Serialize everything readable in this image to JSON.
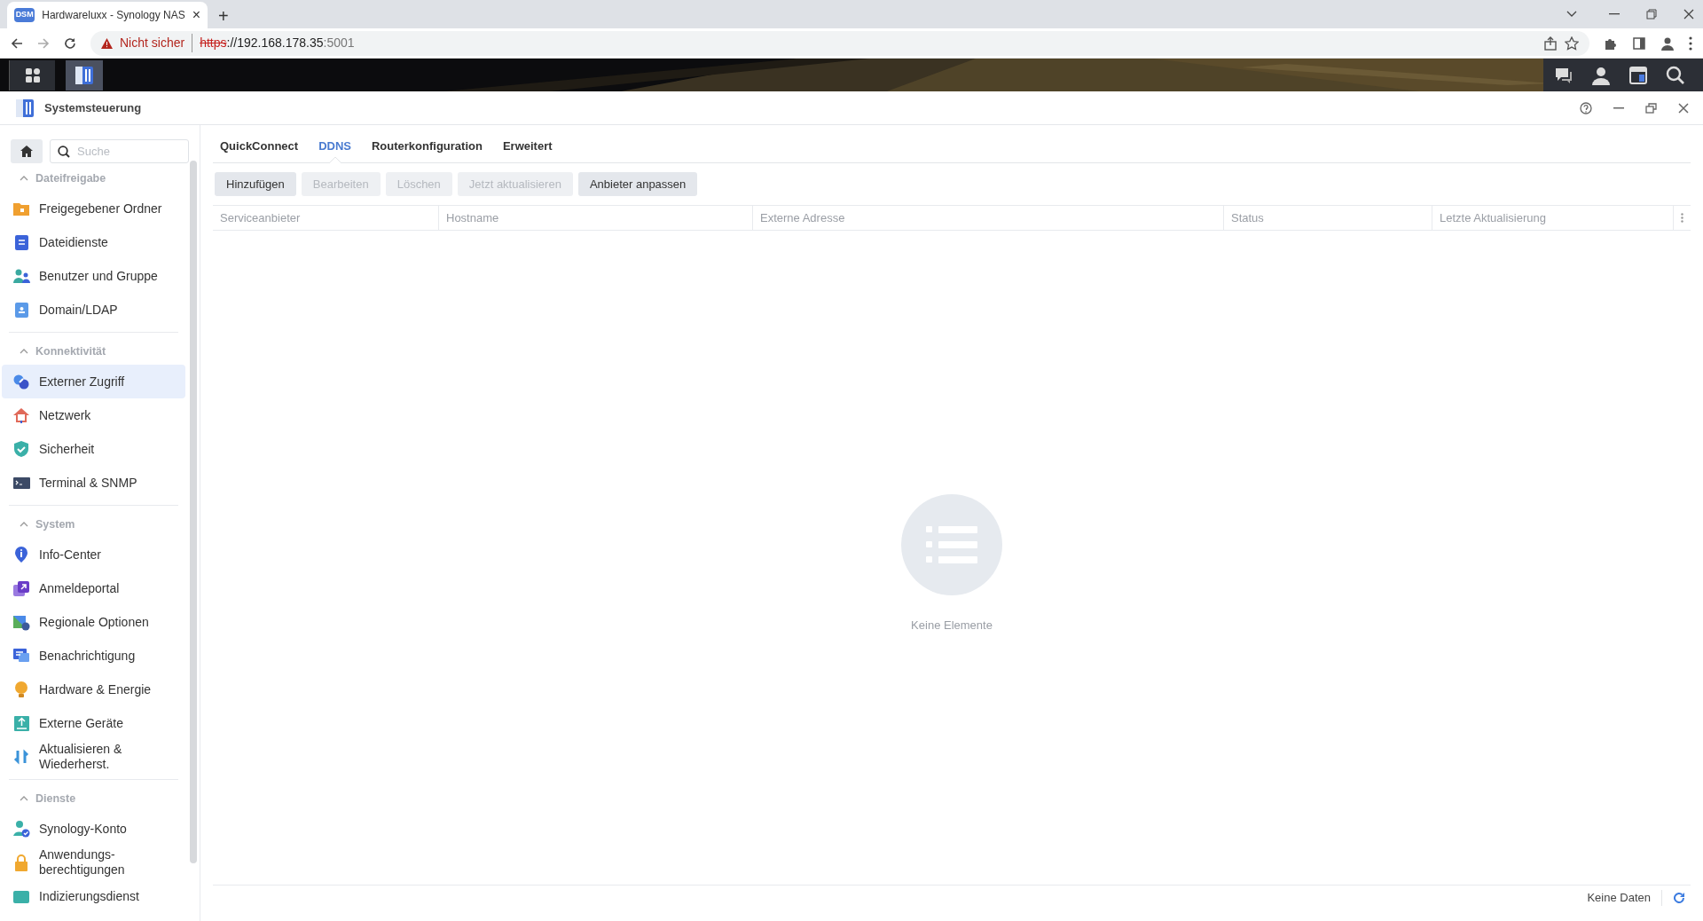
{
  "browser": {
    "tab": {
      "favicon": "DSM",
      "title": "Hardwareluxx - Synology NAS",
      "close": "×"
    },
    "new_tab": "+",
    "address": {
      "warning": "Nicht sicher",
      "scheme": "https",
      "rest": "://192.168.178.35",
      "port": ":5001"
    }
  },
  "window": {
    "title": "Systemsteuerung"
  },
  "sidebar": {
    "search": {
      "placeholder": "Suche"
    },
    "sections": [
      {
        "title": "Dateifreigabe",
        "expanded": true,
        "items": [
          {
            "label": "Freigegebener Ordner",
            "selected": false
          },
          {
            "label": "Dateidienste",
            "selected": false
          },
          {
            "label": "Benutzer und Gruppe",
            "selected": false
          },
          {
            "label": "Domain/LDAP",
            "selected": false
          }
        ]
      },
      {
        "title": "Konnektivität",
        "expanded": true,
        "items": [
          {
            "label": "Externer Zugriff",
            "selected": true
          },
          {
            "label": "Netzwerk",
            "selected": false
          },
          {
            "label": "Sicherheit",
            "selected": false
          },
          {
            "label": "Terminal & SNMP",
            "selected": false
          }
        ]
      },
      {
        "title": "System",
        "expanded": true,
        "items": [
          {
            "label": "Info-Center",
            "selected": false
          },
          {
            "label": "Anmeldeportal",
            "selected": false
          },
          {
            "label": "Regionale Optionen",
            "selected": false
          },
          {
            "label": "Benachrichtigung",
            "selected": false
          },
          {
            "label": "Hardware & Energie",
            "selected": false
          },
          {
            "label": "Externe Geräte",
            "selected": false
          },
          {
            "label": "Aktualisieren & Wiederherst.",
            "selected": false
          }
        ]
      },
      {
        "title": "Dienste",
        "expanded": true,
        "items": [
          {
            "label": "Synology-Konto",
            "selected": false
          },
          {
            "label": "Anwendungs-berechtigungen",
            "selected": false
          },
          {
            "label": "Indizierungsdienst",
            "selected": false
          }
        ]
      }
    ]
  },
  "tabs": [
    {
      "label": "QuickConnect",
      "selected": false
    },
    {
      "label": "DDNS",
      "selected": true
    },
    {
      "label": "Routerkonfiguration",
      "selected": false
    },
    {
      "label": "Erweitert",
      "selected": false
    }
  ],
  "toolbar": [
    {
      "label": "Hinzufügen",
      "disabled": false
    },
    {
      "label": "Bearbeiten",
      "disabled": true
    },
    {
      "label": "Löschen",
      "disabled": true
    },
    {
      "label": "Jetzt aktualisieren",
      "disabled": true
    },
    {
      "label": "Anbieter anpassen",
      "disabled": false
    }
  ],
  "table": {
    "columns": [
      "Serviceanbieter",
      "Hostname",
      "Externe Adresse",
      "Status",
      "Letzte Aktualisierung"
    ],
    "empty_text": "Keine Elemente"
  },
  "status_bar": {
    "text": "Keine Daten"
  }
}
